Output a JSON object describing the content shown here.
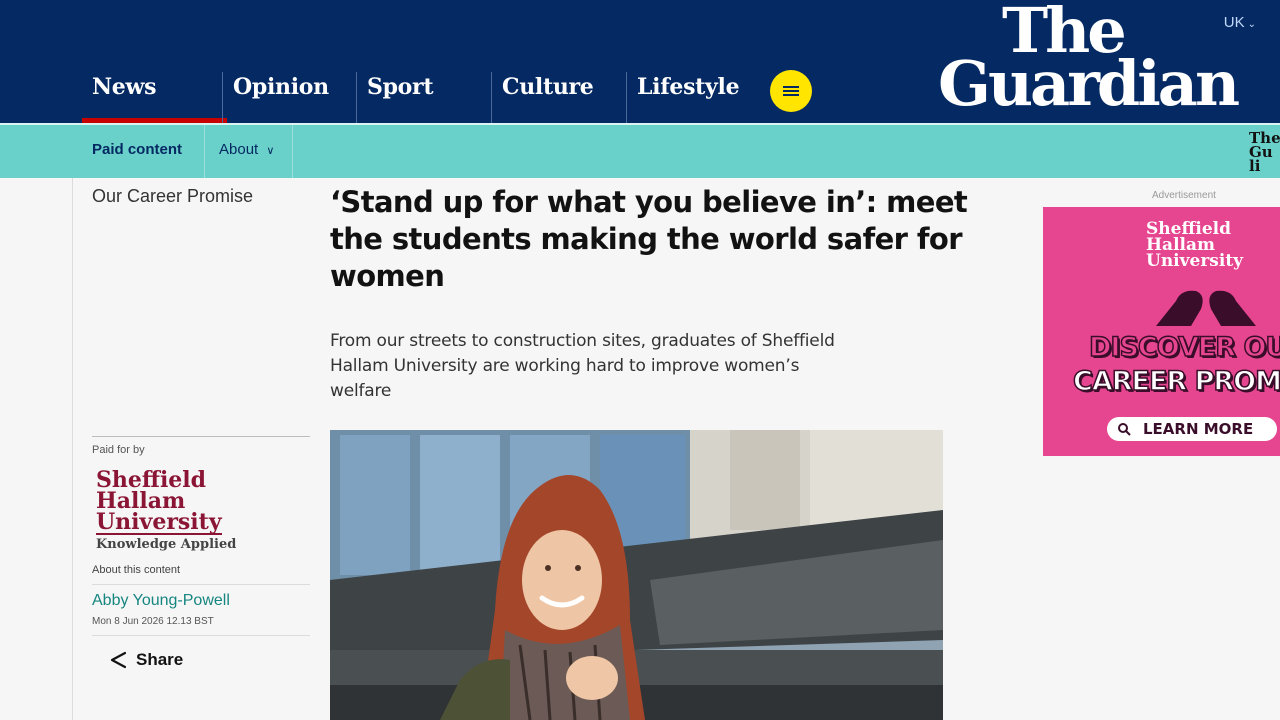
{
  "header": {
    "nav": [
      "News",
      "Opinion",
      "Sport",
      "Culture",
      "Lifestyle"
    ],
    "active_nav": "News",
    "edition": "UK",
    "logo_line1": "The",
    "logo_line2": "Guardian"
  },
  "paid_bar": {
    "label": "Paid content",
    "about": "About",
    "mini_logo": [
      "The",
      "Gu",
      "li"
    ]
  },
  "article": {
    "series": "Our Career Promise",
    "headline": "‘Stand up for what you believe in’: meet the students making the world safer for women",
    "standfirst": "From our streets to construction sites, graduates of Sheffield Hallam University are working hard to improve women’s welfare"
  },
  "meta": {
    "paid_for_label": "Paid for by",
    "sponsor_logo": [
      "Sheffield",
      "Hallam",
      "University"
    ],
    "sponsor_tagline": "Knowledge Applied",
    "about_content": "About this content",
    "author": "Abby Young-Powell",
    "date": "Mon 8 Jun 2026 12.13 BST",
    "share_label": "Share"
  },
  "ad": {
    "label": "Advertisement",
    "logo": [
      "Sheffield",
      "Hallam",
      "University"
    ],
    "headline_line1": "DISCOVER OUR",
    "headline_line2": "CAREER PROMISE",
    "cta": "LEARN MORE"
  },
  "colors": {
    "header_bg": "#052962",
    "menu_button": "#ffe500",
    "paid_bar": "#69d1ca",
    "active_underline": "#c70000",
    "byline": "#168680",
    "sponsor": "#8b1534",
    "ad_bg": "#e6468f"
  }
}
